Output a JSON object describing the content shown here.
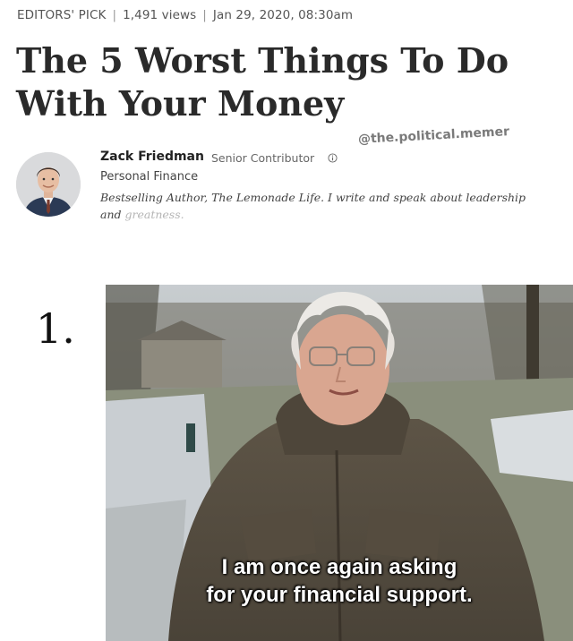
{
  "meta": {
    "label": "EDITORS' PICK",
    "views": "1,491 views",
    "date": "Jan 29, 2020, 08:30am",
    "separator": "|"
  },
  "headline": "The 5 Worst Things To Do With Your Money",
  "watermark": "@the.political.memer",
  "author": {
    "name": "Zack Friedman",
    "role": "Senior Contributor",
    "section": "Personal Finance",
    "bio_main": "Bestselling Author, The Lemonade Life. I write and speak about leadership and",
    "bio_fade": "greatness."
  },
  "list_number": "1.",
  "meme": {
    "caption_line1": "I am once again asking",
    "caption_line2": "for your financial support."
  },
  "colors": {
    "headline": "#2a2a2a",
    "meta_text": "#555555",
    "caption": "#ffffff"
  }
}
